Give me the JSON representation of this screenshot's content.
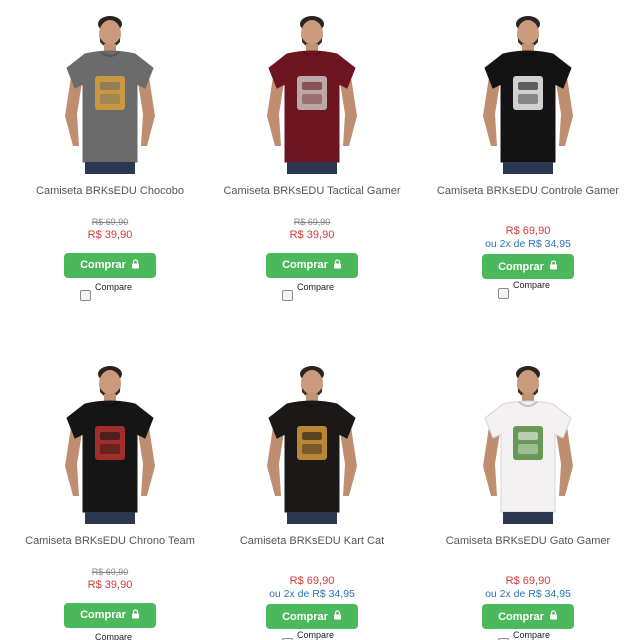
{
  "products": [
    {
      "name": "Camiseta BRKsEDU Chocobo",
      "old_price": "R$ 69,90",
      "price": "R$ 39,90",
      "installment": "",
      "buy_label": "Comprar",
      "compare_label": "Compare",
      "shirt_color": "#6b6b6b",
      "print_color": "#d9a13a"
    },
    {
      "name": "Camiseta BRKsEDU Tactical Gamer",
      "old_price": "R$ 69,90",
      "price": "R$ 39,90",
      "installment": "",
      "buy_label": "Comprar",
      "compare_label": "Compare",
      "shirt_color": "#6e1620",
      "print_color": "#c9c2c2"
    },
    {
      "name": "Camiseta BRKsEDU Controle Gamer",
      "old_price": "",
      "price": "R$ 69,90",
      "installment": "ou 2x de R$ 34,95",
      "buy_label": "Comprar",
      "compare_label": "Compare",
      "shirt_color": "#131313",
      "print_color": "#f2f2f2"
    },
    {
      "name": "Camiseta BRKsEDU Chrono Team",
      "old_price": "R$ 69,90",
      "price": "R$ 39,90",
      "installment": "",
      "buy_label": "Comprar",
      "compare_label": "Compare",
      "shirt_color": "#151515",
      "print_color": "#b8332f"
    },
    {
      "name": "Camiseta BRKsEDU Kart Cat",
      "old_price": "",
      "price": "R$ 69,90",
      "installment": "ou 2x de R$ 34,95",
      "buy_label": "Comprar",
      "compare_label": "Compare",
      "shirt_color": "#1b1818",
      "print_color": "#d69a3a"
    },
    {
      "name": "Camiseta BRKsEDU Gato Gamer",
      "old_price": "",
      "price": "R$ 69,90",
      "installment": "ou 2x de R$ 34,95",
      "buy_label": "Comprar",
      "compare_label": "Compare",
      "shirt_color": "#f3f1f1",
      "print_color": "#4f8a3c"
    }
  ],
  "colors": {
    "button_green": "#4cb85c",
    "price_red": "#d43a3a",
    "installment_blue": "#2c74b5"
  },
  "icons": {
    "buy_button_icon": "lock-icon"
  }
}
